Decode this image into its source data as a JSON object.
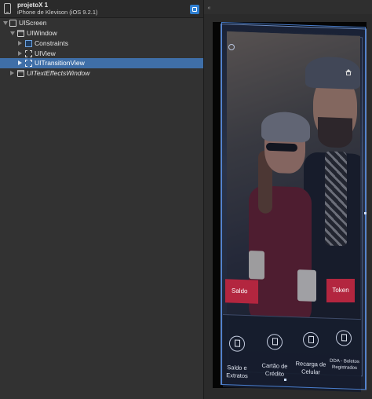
{
  "header": {
    "project_name": "projetoX 1",
    "device": "iPhone de Klevison (iOS 9.2.1)"
  },
  "tree": [
    {
      "label": "UIScreen",
      "icon": "screen-icon",
      "expanded": true
    },
    {
      "label": "UIWindow",
      "icon": "window-icon",
      "expanded": true
    },
    {
      "label": "Constraints",
      "icon": "constraints-icon",
      "expanded": false
    },
    {
      "label": "UIView",
      "icon": "view-icon",
      "expanded": false
    },
    {
      "label": "UITransitionView",
      "icon": "view-icon",
      "expanded": false,
      "selected": true
    },
    {
      "label": "UITextEffectsWindow",
      "icon": "window-icon",
      "expanded": false
    }
  ],
  "canvas": {
    "collapse_label": "«",
    "saldo_button": "Saldo",
    "token_button": "Token",
    "tabs": [
      {
        "label_line1": "Saldo e",
        "label_line2": "Extratos"
      },
      {
        "label_line1": "Cartão de",
        "label_line2": "Crédito"
      },
      {
        "label_line1": "Recarga de",
        "label_line2": "Celular"
      },
      {
        "label_line1": "DDA - Boletos",
        "label_line2": "Registrados"
      }
    ]
  },
  "colors": {
    "selection": "#3f6fa8",
    "accent_red": "#b3263f",
    "outline_blue": "#4a7fd0"
  }
}
